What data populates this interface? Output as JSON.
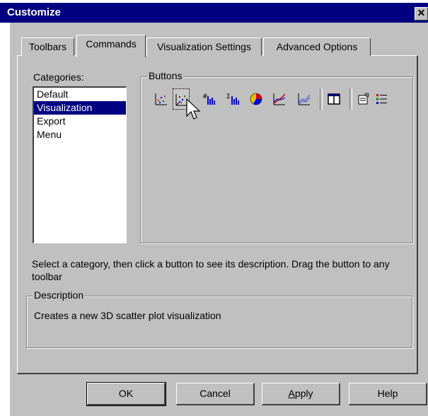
{
  "window": {
    "title": "Customize",
    "close_glyph": "✕"
  },
  "tabs": [
    {
      "label": "Toolbars"
    },
    {
      "label": "Commands"
    },
    {
      "label": "Visualization Settings"
    },
    {
      "label": "Advanced Options"
    }
  ],
  "categories": {
    "label": "Categories:",
    "items": [
      "Default",
      "Visualization",
      "Export",
      "Menu"
    ],
    "selected": "Visualization"
  },
  "buttons_group": {
    "label": "Buttons",
    "icons": [
      "scatter-plot-icon",
      "3d-scatter-plot-icon",
      "histogram-icon",
      "sum-histogram-icon",
      "pie-chart-icon",
      "line-chart-icon",
      "multi-line-chart-icon",
      "panel-layout-icon",
      "properties-icon",
      "legend-list-icon"
    ],
    "pressed": "3d-scatter-plot-icon"
  },
  "hint": "Select a category, then click a button to see its description. Drag the button to any toolbar",
  "description": {
    "label": "Description",
    "text": "Creates a new 3D scatter plot visualization"
  },
  "footer": {
    "ok": "OK",
    "cancel": "Cancel",
    "apply": "Apply",
    "help": "Help"
  },
  "colors": {
    "titlebar": "#000080",
    "face": "#c0c0c0",
    "selection": "#000080"
  }
}
